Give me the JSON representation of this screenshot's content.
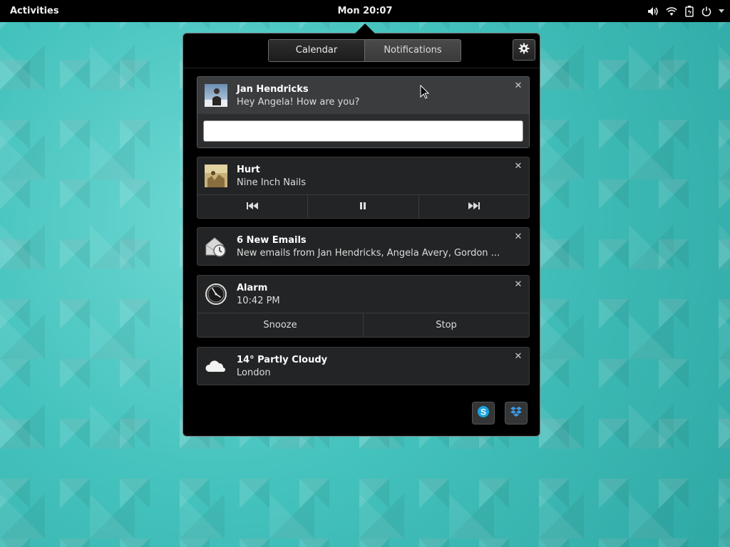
{
  "topbar": {
    "activities_label": "Activities",
    "clock": "Mon 20:07",
    "status_icons": [
      "volume-icon",
      "wifi-icon",
      "battery-icon",
      "power-icon",
      "chevron-down-icon"
    ]
  },
  "message_tray": {
    "tabs": [
      {
        "label": "Calendar",
        "active": false
      },
      {
        "label": "Notifications",
        "active": true
      }
    ],
    "settings_icon": "gear-icon",
    "notifications": [
      {
        "id": "chat",
        "title": "Jan Hendricks",
        "body": "Hey Angela! How are you?",
        "icon": "avatar",
        "reply_value": "",
        "reply_placeholder": ""
      },
      {
        "id": "music",
        "title": "Hurt",
        "body": "Nine Inch Nails",
        "icon": "album-art",
        "controls": [
          "previous-icon",
          "pause-icon",
          "next-icon"
        ]
      },
      {
        "id": "email",
        "title": "6 New Emails",
        "body": "New emails from Jan Hendricks, Angela Avery, Gordon ...",
        "icon": "mail-icon"
      },
      {
        "id": "alarm",
        "title": "Alarm",
        "body": "10:42 PM",
        "icon": "clock-icon",
        "actions": [
          "Snooze",
          "Stop"
        ]
      },
      {
        "id": "weather",
        "title": "14° Partly Cloudy",
        "body": "London",
        "icon": "cloud-icon"
      }
    ],
    "tray_apps": [
      "skype-icon",
      "dropbox-icon"
    ]
  },
  "colors": {
    "desktop": "#3fbdb9",
    "panel": "#000000",
    "card": "#222425",
    "card_highlight": "#3a3c3e"
  }
}
